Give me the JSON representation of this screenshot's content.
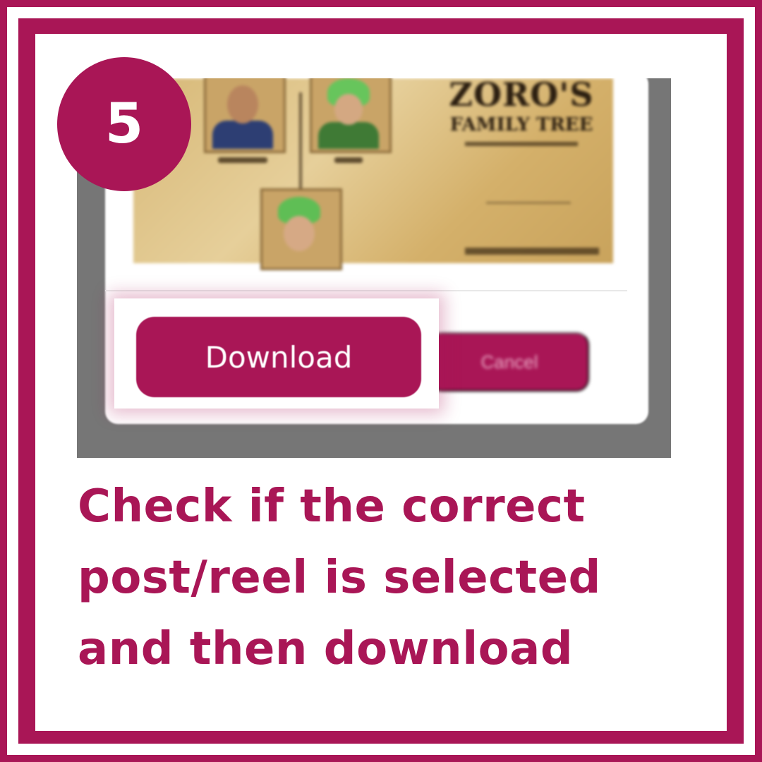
{
  "step": {
    "number": "5"
  },
  "screenshot": {
    "poster_title": "ZORO'S",
    "poster_subtitle": "FAMILY TREE",
    "download_label": "Download",
    "cancel_label": "Cancel"
  },
  "instruction": {
    "line1": "Check if the correct",
    "line2": "post/reel is selected",
    "line3": "and then download"
  },
  "colors": {
    "brand": "#a91656",
    "screenshot_backdrop": "#767676",
    "background": "#ffffff"
  }
}
